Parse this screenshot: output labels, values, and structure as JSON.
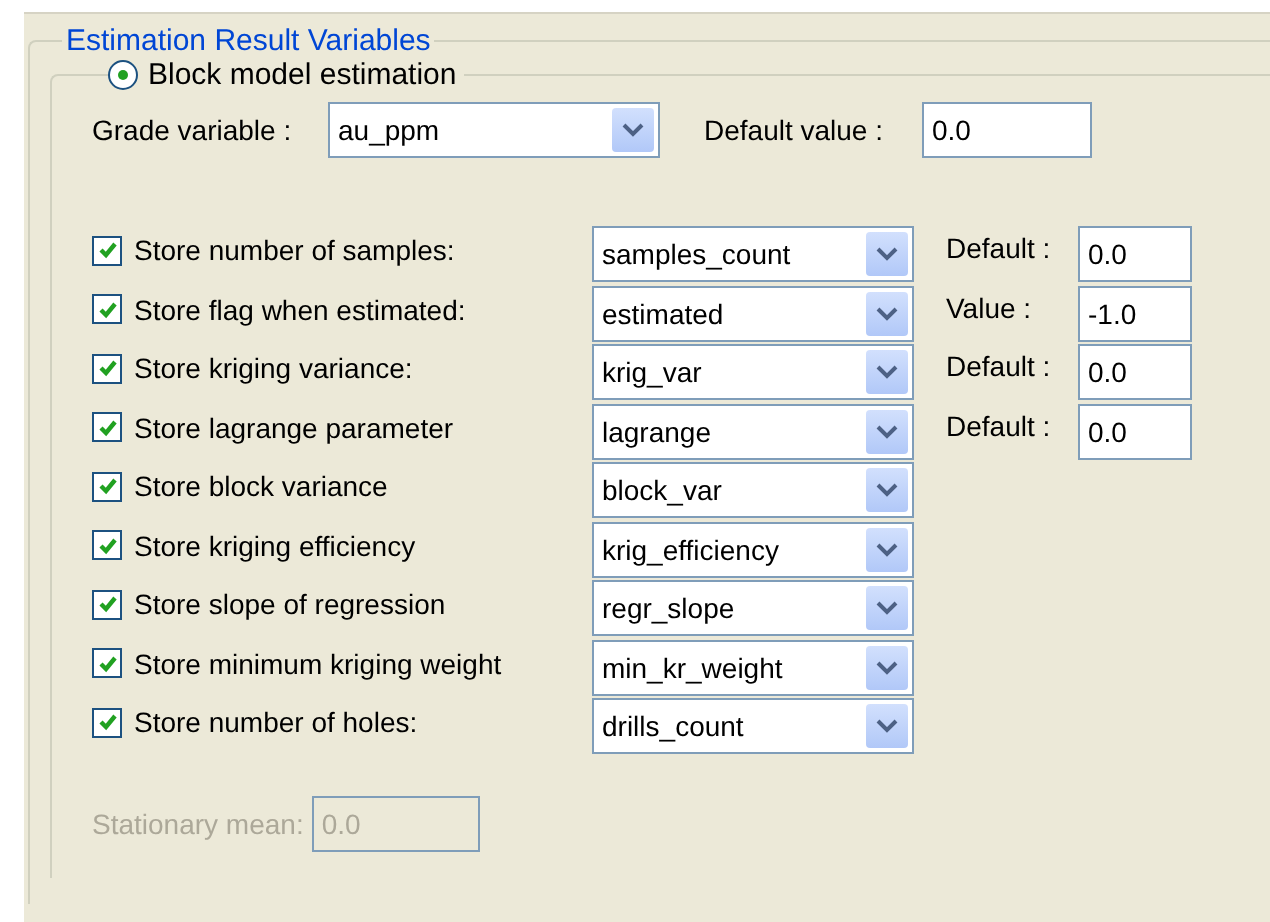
{
  "group": {
    "title": "Estimation Result Variables"
  },
  "mode": {
    "label": "Block model estimation",
    "selected": true
  },
  "grade": {
    "label": "Grade variable :",
    "value": "au_ppm"
  },
  "default_value": {
    "label": "Default value :",
    "value": "0.0"
  },
  "outputs": [
    {
      "label": "Store number of samples:",
      "checked": true,
      "variable": "samples_count",
      "side": {
        "label": "Default :",
        "value": "0.0"
      }
    },
    {
      "label": "Store flag when estimated:",
      "checked": true,
      "variable": "estimated",
      "side": {
        "label": "Value :",
        "value": "-1.0"
      }
    },
    {
      "label": "Store kriging variance:",
      "checked": true,
      "variable": "krig_var",
      "side": {
        "label": "Default :",
        "value": "0.0"
      }
    },
    {
      "label": "Store lagrange parameter",
      "checked": true,
      "variable": "lagrange",
      "side": {
        "label": "Default :",
        "value": "0.0"
      }
    },
    {
      "label": "Store block variance",
      "checked": true,
      "variable": "block_var"
    },
    {
      "label": "Store kriging efficiency",
      "checked": true,
      "variable": "krig_efficiency"
    },
    {
      "label": "Store slope of regression",
      "checked": true,
      "variable": "regr_slope"
    },
    {
      "label": "Store minimum kriging weight",
      "checked": true,
      "variable": "min_kr_weight"
    },
    {
      "label": "Store number of holes:",
      "checked": true,
      "variable": "drills_count"
    }
  ],
  "stationary_mean": {
    "label": "Stationary mean:",
    "value": "0.0",
    "disabled": true
  }
}
